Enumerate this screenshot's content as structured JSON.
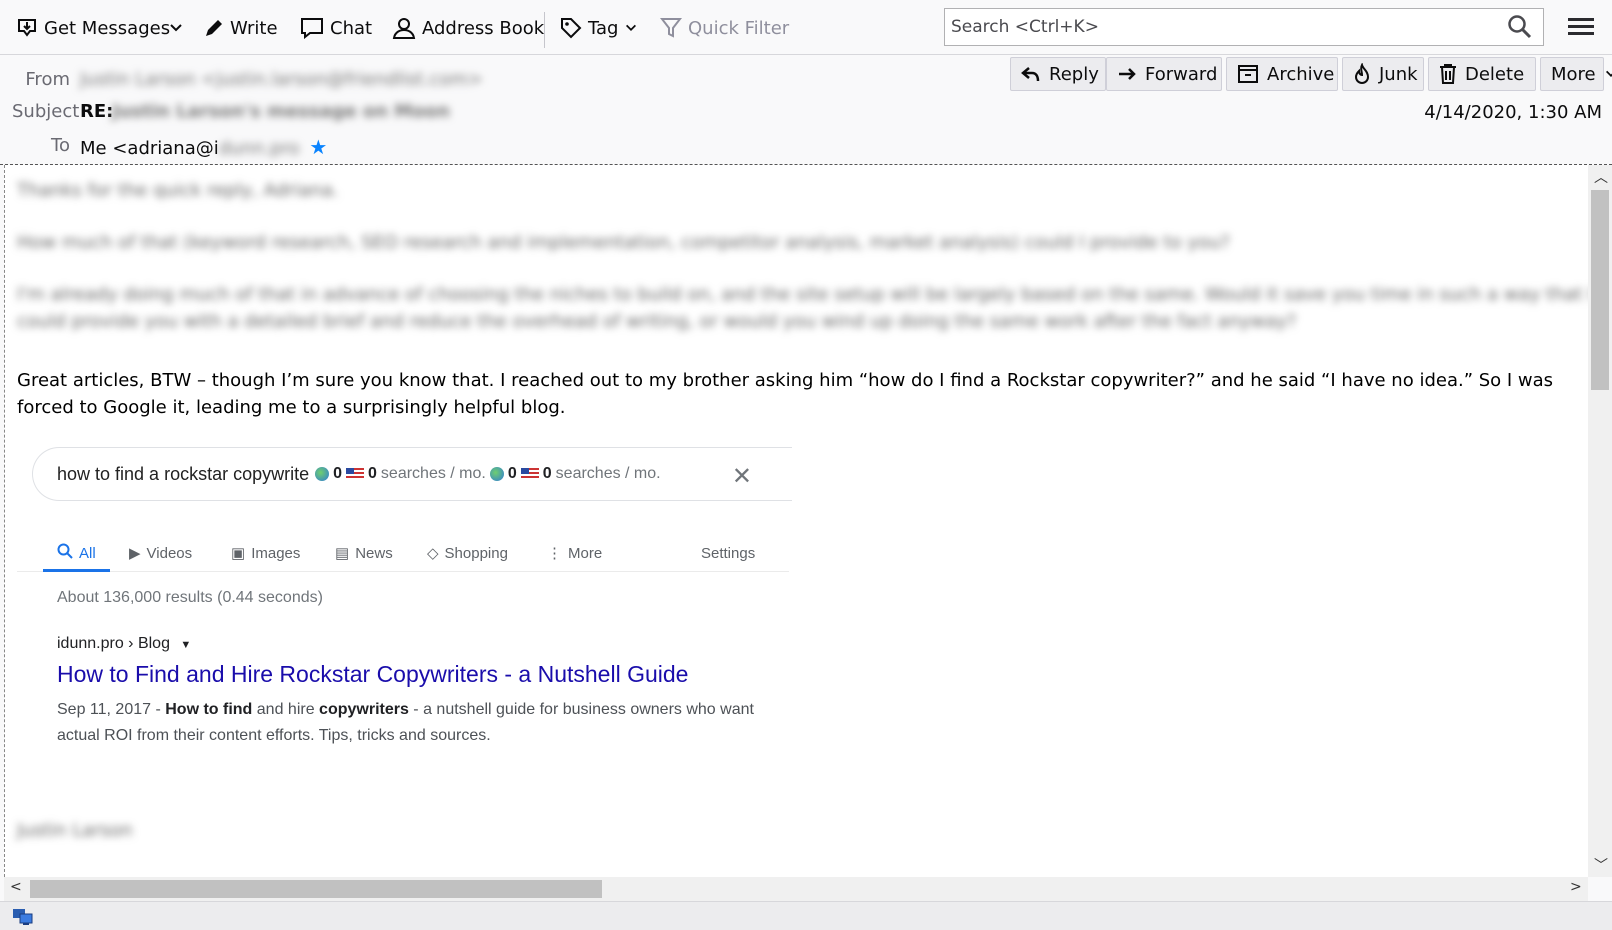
{
  "toolbar": {
    "get_messages": "Get Messages",
    "write": "Write",
    "chat": "Chat",
    "address_book": "Address Book",
    "tag": "Tag",
    "quick_filter": "Quick Filter",
    "search_placeholder": "Search <Ctrl+K>"
  },
  "header": {
    "from_label": "From",
    "from_value": "Justin Larson <justin.larson@friendlist.com>",
    "subject_label": "Subject",
    "subject_prefix": "RE:",
    "subject_value": "Justin Larson's message on Moon",
    "to_label": "To",
    "to_value": "Me <adriana@i",
    "to_value_blur": "dunn.pro",
    "date": "4/14/2020, 1:30 AM",
    "actions": {
      "reply": "Reply",
      "forward": "Forward",
      "archive": "Archive",
      "junk": "Junk",
      "delete": "Delete",
      "more": "More"
    }
  },
  "body": {
    "blur_line_1": "Thanks for the quick reply, Adriana.",
    "blur_line_2": "How much of that (keyword research, SEO research and implementation, competitor analysis, market analysis) could I provide to you?",
    "blur_line_3": "I'm already doing much of that in advance of choosing the niches to build on, and the site setup will be largely based on the same. Would it save you time in such a way that I",
    "blur_line_4": "could provide you with a detailed brief and reduce the overhead of writing, or would you wind up doing the same work after the fact anyway?",
    "main_paragraph": "Great articles, BTW – though I’m sure you know that. I reached out to my brother asking him “how do I find a  Rockstar copywriter?” and he said “I have no idea.” So I was forced to Google it, leading me to a surprisingly helpful blog.",
    "signature": "Justin Larson"
  },
  "google": {
    "query": "how to find a rockstar copywrite",
    "kw_count_1": "0",
    "kw_count_2": "0",
    "kw_suffix": "searches / mo.",
    "kw_count_3": "0",
    "kw_count_4": "0",
    "tabs": {
      "all": "All",
      "videos": "Videos",
      "images": "Images",
      "news": "News",
      "shopping": "Shopping",
      "more": "More",
      "settings": "Settings"
    },
    "results_count": "About 136,000 results (0.44 seconds)",
    "breadcrumb": "idunn.pro › Blog",
    "result_title": "How to Find and Hire Rockstar Copywriters - a Nutshell Guide",
    "snippet_date": "Sep 11, 2017 - ",
    "snippet_b1": "How to find",
    "snippet_t1": " and hire ",
    "snippet_b2": "copywriters",
    "snippet_t2": " - a nutshell guide for business owners who want actual ROI from their content efforts. Tips, tricks and sources."
  },
  "colors": {
    "link": "#1a0dab",
    "google_blue": "#1a73e8",
    "star": "#0a84ff"
  }
}
